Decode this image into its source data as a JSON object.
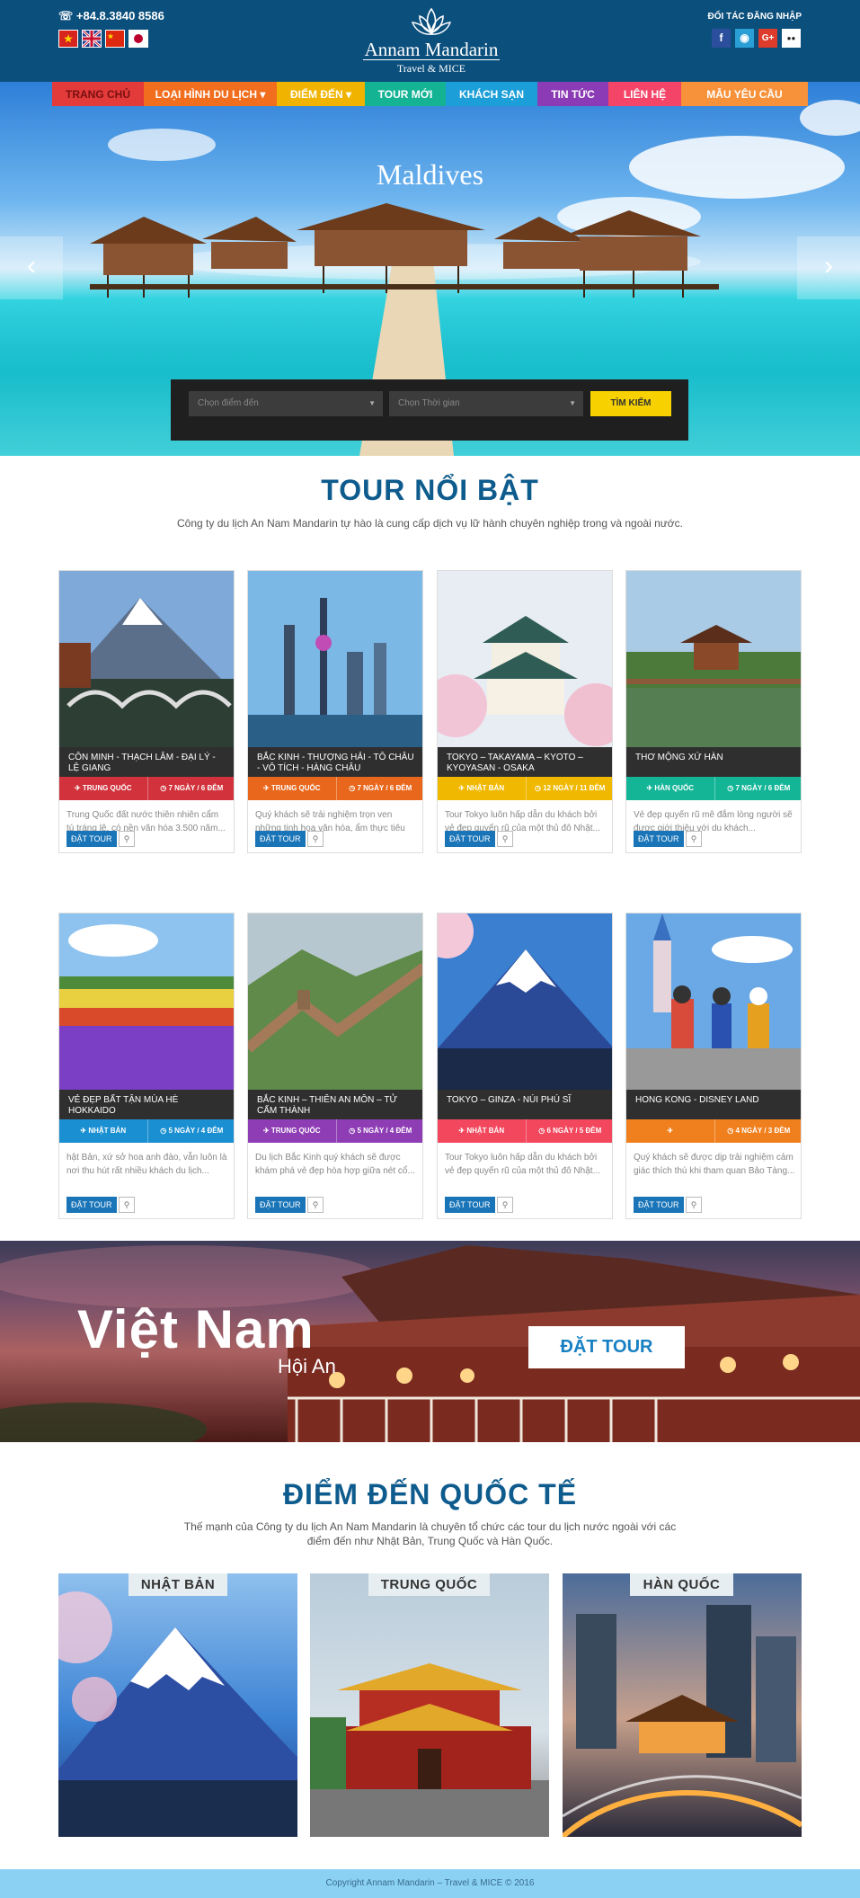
{
  "header": {
    "phone": "☏ +84.8.3840 8586",
    "partner_login": "ĐỐI TÁC ĐĂNG NHẬP",
    "brand_name": "Annam Mandarin",
    "brand_sub": "Travel & MICE",
    "social": [
      "f",
      "◉",
      "G+",
      "●●"
    ]
  },
  "nav": [
    {
      "label": "TRANG CHỦ",
      "color": "#e33a3a",
      "text": "#7a1010"
    },
    {
      "label": "LOẠI HÌNH DU LỊCH ▾",
      "color": "#f06e1e"
    },
    {
      "label": "ĐIỂM ĐẾN ▾",
      "color": "#f0b400"
    },
    {
      "label": "TOUR MỚI",
      "color": "#13b394"
    },
    {
      "label": "KHÁCH SẠN",
      "color": "#1c9fd8"
    },
    {
      "label": "TIN TỨC",
      "color": "#8b3bb5"
    },
    {
      "label": "LIÊN HỆ",
      "color": "#f44568"
    },
    {
      "label": "MẪU YÊU CẦU",
      "color": "#f7923a"
    }
  ],
  "hero": {
    "title": "Maldives",
    "prev_arrow": "‹",
    "next_arrow": "›",
    "search": {
      "destination_placeholder": "Chọn điểm đến",
      "time_placeholder": "Chọn Thời gian",
      "button": "TÌM KIẾM"
    }
  },
  "featured": {
    "title": "TOUR NỔI BẬT",
    "description": "Công ty du lịch An Nam Mandarin tự hào là cung cấp dịch vụ lữ hành chuyên nghiệp trong và ngoài nước.",
    "book_label": "ĐẶT TOUR",
    "pin_icon": "⚲",
    "tours": [
      {
        "title": "CÔN MINH - THẠCH LÂM - ĐẠI LÝ - LỆ GIANG",
        "country": "✈ TRUNG QUỐC",
        "duration": "◷ 7 Ngày / 6 Đêm",
        "color": "#d1323c",
        "desc": "Trung Quốc đất nước thiên nhiên cẩm tú tráng lệ, có nền văn hóa 3.500 năm..."
      },
      {
        "title": "BẮC KINH - THƯỢNG HẢI - TÔ CHÂU - VÔ TÍCH - HÀNG CHÂU",
        "country": "✈ TRUNG QUỐC",
        "duration": "◷ 7 Ngày / 6 Đêm",
        "color": "#e8671c",
        "desc": "Quý khách sẽ trải nghiệm trọn ven những tinh hoa văn hóa, ẩm thực tiêu biểu..."
      },
      {
        "title": "TOKYO – TAKAYAMA – KYOTO – KYOYASAN - OSAKA",
        "country": "✈ NHẬT BẢN",
        "duration": "◷ 12 Ngày / 11 Đêm",
        "color": "#f0b800",
        "desc": "Tour Tokyo luôn hấp dẫn du khách bởi vẻ đẹp quyến rũ của một thủ đô Nhật..."
      },
      {
        "title": "THƠ MỘNG XỨ HÀN",
        "country": "✈ HÀN QUỐC",
        "duration": "◷ 7 Ngày / 6 Đêm",
        "color": "#14b597",
        "desc": "Vẻ đẹp quyến rũ mê đắm lòng người sẽ được giới thiệu với du khách..."
      },
      {
        "title": "VẺ ĐẸP BẤT TẬN MÙA HÈ HOKKAIDO",
        "country": "✈ NHẬT BẢN",
        "duration": "◷ 5 Ngày / 4 Đêm",
        "color": "#1a8fd1",
        "desc": "hật Bản, xứ sở hoa anh đào, vẫn luôn là nơi thu hút rất nhiều khách du lịch..."
      },
      {
        "title": "BẮC KINH – THIÊN AN MÔN – TỬ CẤM THÀNH",
        "country": "✈ TRUNG QUỐC",
        "duration": "◷ 5 Ngày / 4 Đêm",
        "color": "#8e3db5",
        "desc": "Du lịch Bắc Kinh quý khách sẽ được khám phá vẻ đẹp hòa hợp giữa nét cổ..."
      },
      {
        "title": "TOKYO – GINZA - NÚI PHÚ SĨ",
        "country": "✈ NHẬT BẢN",
        "duration": "◷ 6 Ngày / 5 Đêm",
        "color": "#f2475c",
        "desc": "Tour Tokyo luôn hấp dẫn du khách bởi vẻ đẹp quyến rũ của một thủ đô Nhật..."
      },
      {
        "title": "HONG KONG - DISNEY LAND",
        "country": "✈",
        "duration": "◷ 4 Ngày / 3 Đêm",
        "color": "#f0801e",
        "desc": "Quý khách sẽ được dịp trải nghiệm cảm giác thích thú khi tham quan Bảo Tàng..."
      }
    ]
  },
  "banner": {
    "title": "Việt Nam",
    "subtitle": "Hội An",
    "button": "ĐẶT TOUR"
  },
  "destinations": {
    "title": "ĐIỂM ĐẾN QUỐC TẾ",
    "description": "Thế mạnh của Công ty du lịch An Nam Mandarin là chuyên tổ chức các tour du lịch nước ngoài với các điểm đến như Nhật Bản, Trung Quốc và Hàn Quốc.",
    "items": [
      {
        "label": "NHẬT BẢN"
      },
      {
        "label": "TRUNG QUỐC"
      },
      {
        "label": "HÀN QUỐC"
      }
    ]
  },
  "footer": {
    "copyright": "Copyright Annam Mandarin – Travel & MICE © 2016"
  }
}
